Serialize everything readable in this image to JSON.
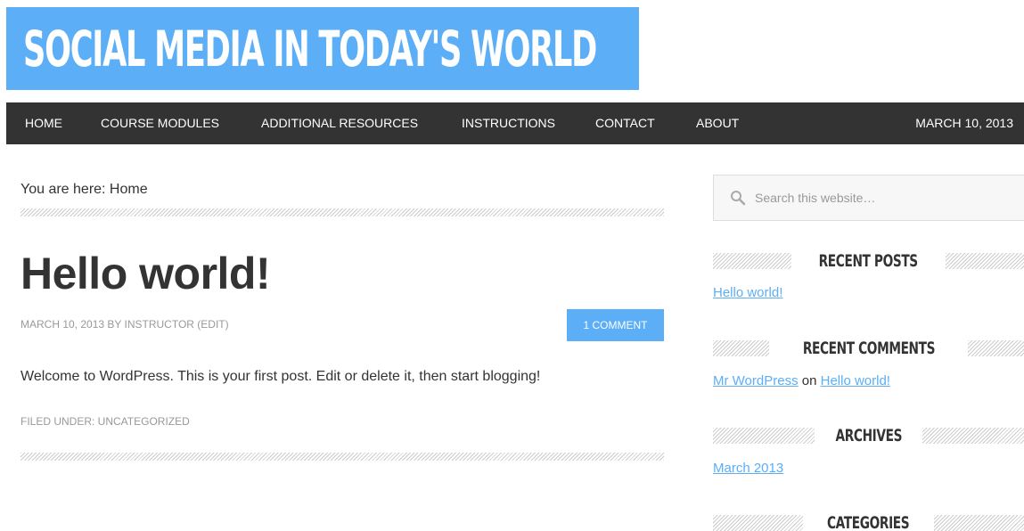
{
  "site": {
    "title": "SOCIAL MEDIA IN TODAY'S WORLD"
  },
  "nav": {
    "items": [
      {
        "label": "HOME"
      },
      {
        "label": "COURSE MODULES"
      },
      {
        "label": "ADDITIONAL RESOURCES"
      },
      {
        "label": "INSTRUCTIONS"
      },
      {
        "label": "CONTACT"
      },
      {
        "label": "ABOUT"
      }
    ],
    "date": "MARCH 10, 2013"
  },
  "breadcrumb": "You are here: Home",
  "post": {
    "title": "Hello world!",
    "meta": "MARCH 10, 2013 BY INSTRUCTOR (EDIT)",
    "comment_button": "1 COMMENT",
    "body": "Welcome to WordPress. This is your first post. Edit or delete it, then start blogging!",
    "filed": "FILED UNDER: UNCATEGORIZED"
  },
  "sidebar": {
    "search_placeholder": "Search this website…",
    "recent_posts": {
      "title": "RECENT POSTS",
      "items": [
        "Hello world!"
      ]
    },
    "recent_comments": {
      "title": "RECENT COMMENTS",
      "author": "Mr WordPress",
      "on": "on",
      "post": "Hello world!"
    },
    "archives": {
      "title": "ARCHIVES",
      "items": [
        "March 2013"
      ]
    },
    "categories": {
      "title": "CATEGORIES"
    }
  },
  "colors": {
    "accent": "#5caef7",
    "nav_bg": "#333333",
    "text": "#333333",
    "meta": "#999999"
  },
  "icons": {
    "search": "search-icon"
  }
}
